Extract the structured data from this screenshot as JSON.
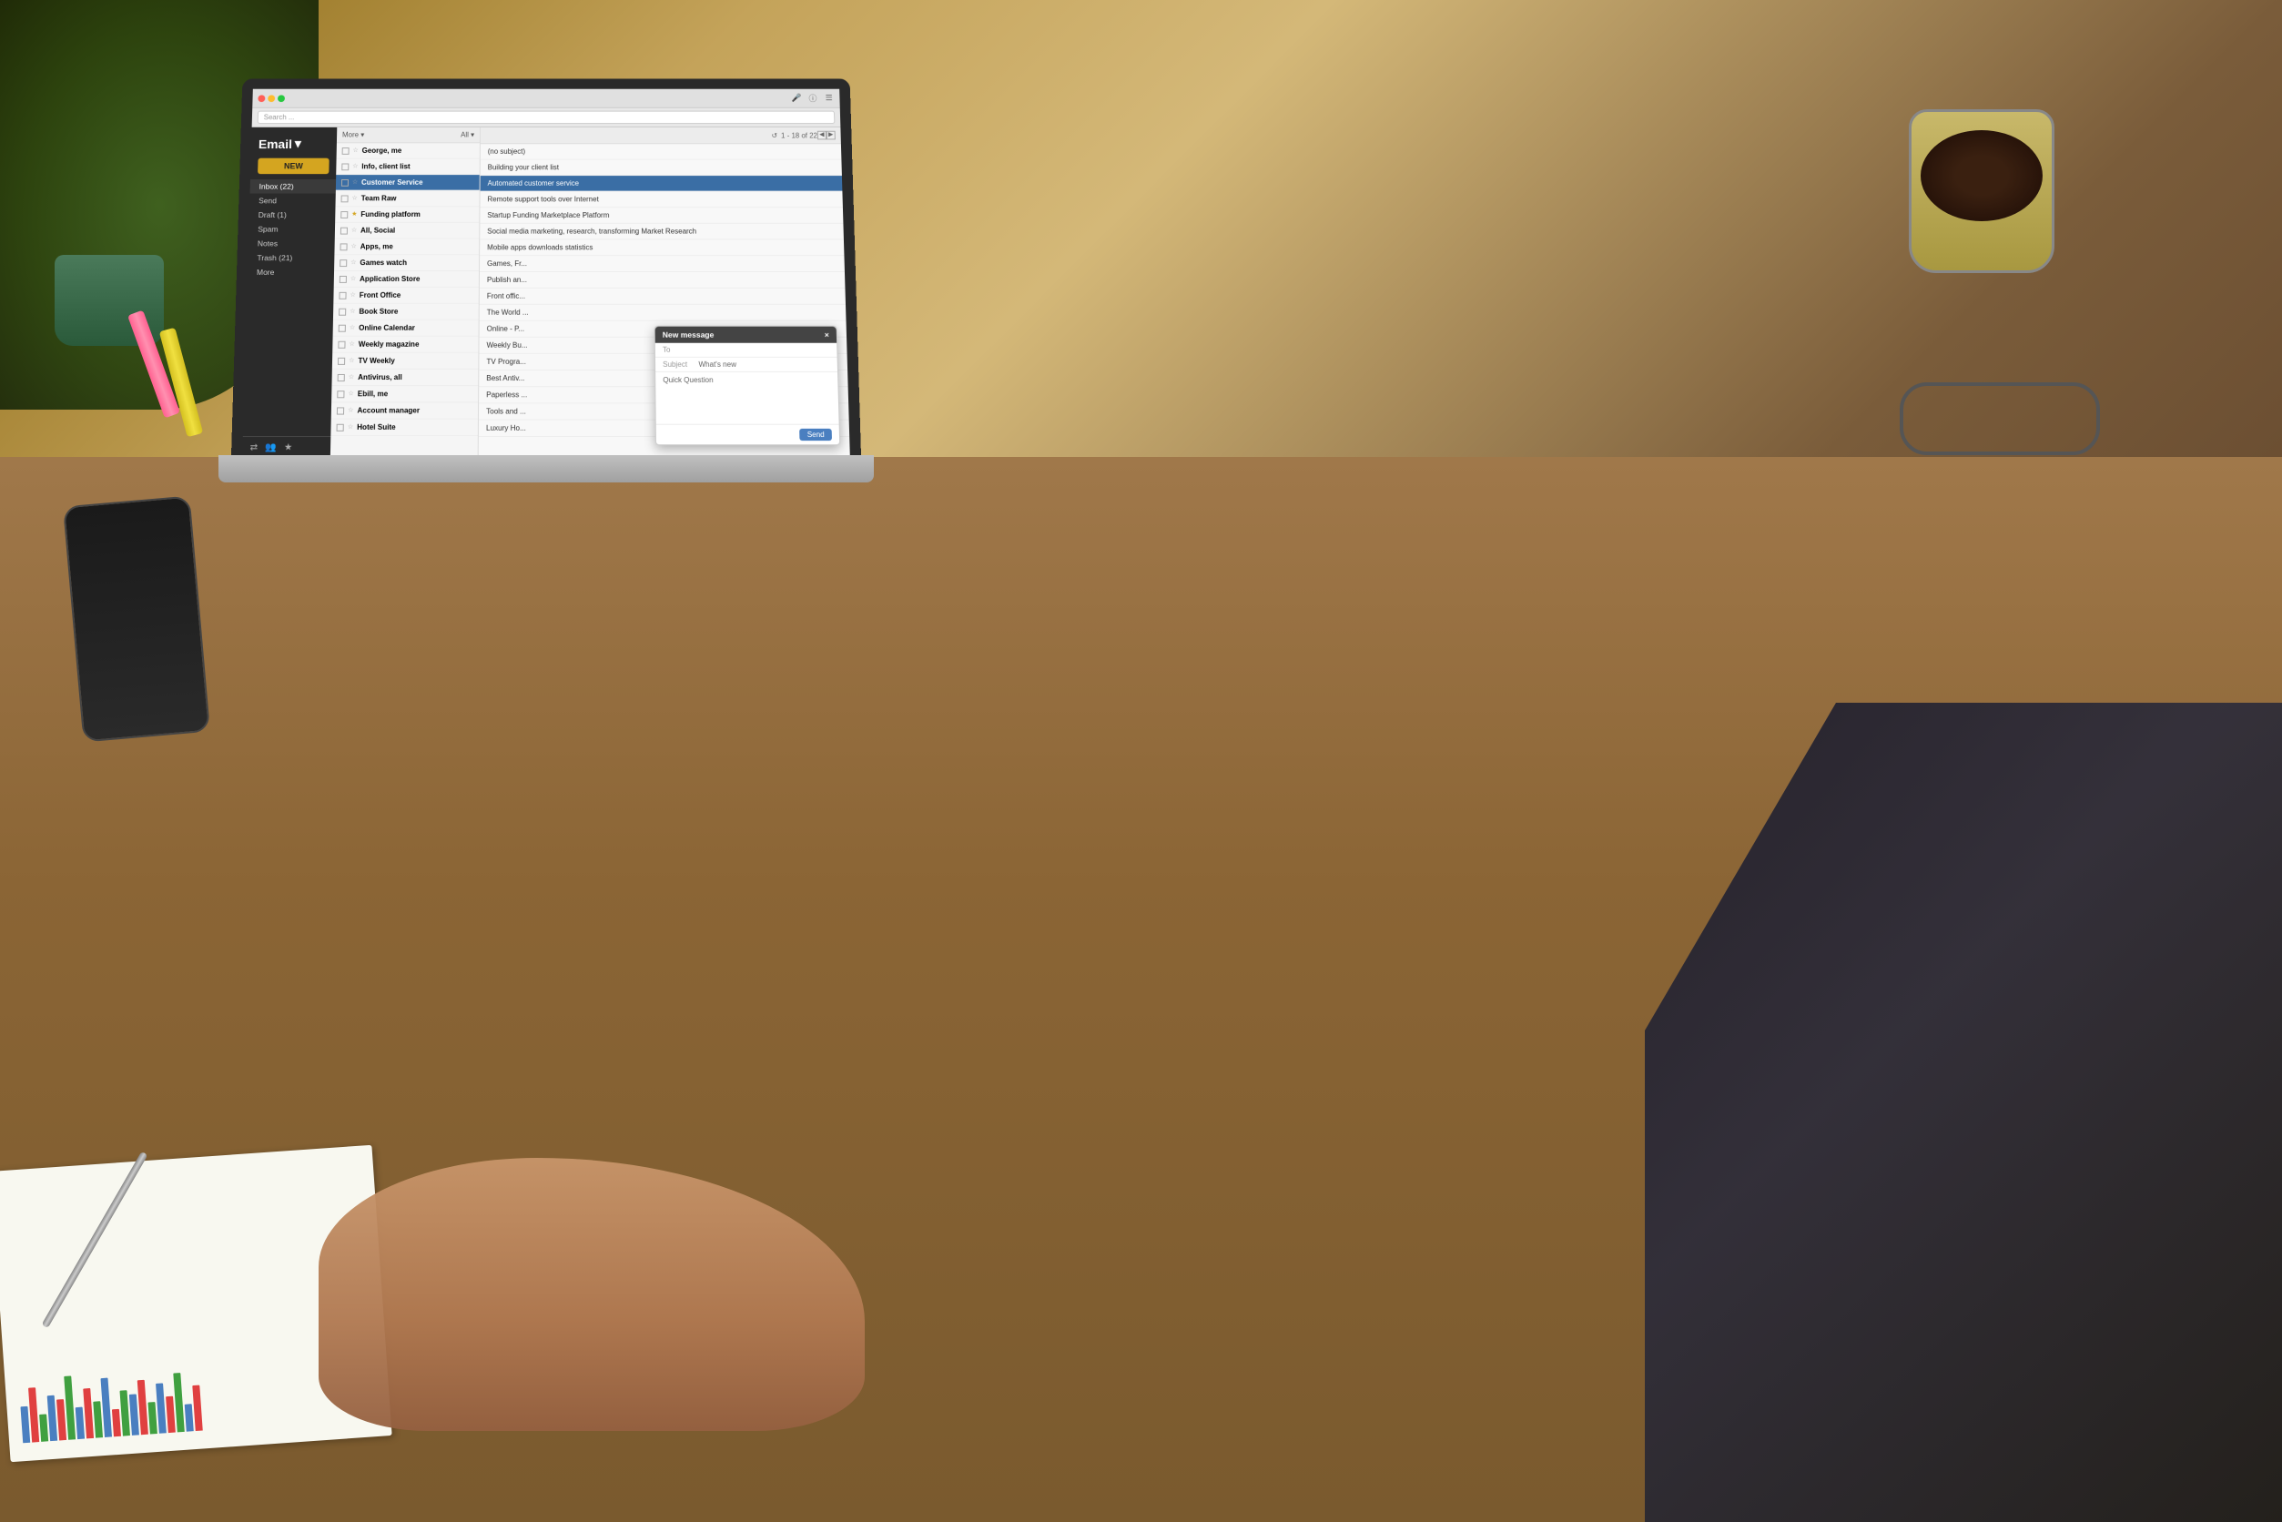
{
  "scene": {
    "bg_color": "#7a5c3a",
    "desk_color": "#9a7040"
  },
  "email_app": {
    "title": "Email",
    "title_arrow": "▾",
    "new_button": "NEW",
    "search_placeholder": "Search ...",
    "topbar": {
      "page_info": "1 - 18 of 22",
      "scroll_left": "◀",
      "scroll_right": "▶",
      "microphone_icon": "🎤",
      "hamburger_icon": "☰",
      "info_icon": "ⓘ"
    },
    "more_label": "More ▾",
    "all_label": "All ▾",
    "sidebar_items": [
      {
        "label": "Inbox (22)",
        "active": true
      },
      {
        "label": "Send",
        "active": false
      },
      {
        "label": "Draft (1)",
        "active": false
      },
      {
        "label": "Spam",
        "active": false
      },
      {
        "label": "Notes",
        "active": false
      },
      {
        "label": "Trash (21)",
        "active": false
      },
      {
        "label": "More",
        "active": false
      }
    ],
    "email_list": [
      {
        "sender": "George, me",
        "starred": false,
        "flag": false
      },
      {
        "sender": "Info, client list",
        "starred": false,
        "flag": false
      },
      {
        "sender": "Customer Service",
        "starred": false,
        "flag": false
      },
      {
        "sender": "Team Raw",
        "starred": false,
        "flag": false
      },
      {
        "sender": "Funding platform",
        "starred": false,
        "flag": true
      },
      {
        "sender": "All, Social",
        "starred": false,
        "flag": false
      },
      {
        "sender": "Apps, me",
        "starred": false,
        "flag": false
      },
      {
        "sender": "Games watch",
        "starred": false,
        "flag": false
      },
      {
        "sender": "Application Store",
        "starred": false,
        "flag": false
      },
      {
        "sender": "Front Office",
        "starred": false,
        "flag": false
      },
      {
        "sender": "Book Store",
        "starred": false,
        "flag": false
      },
      {
        "sender": "Online Calendar",
        "starred": false,
        "flag": false
      },
      {
        "sender": "Weekly magazine",
        "starred": false,
        "flag": false
      },
      {
        "sender": "TV Weekly",
        "starred": false,
        "flag": false
      },
      {
        "sender": "Antivirus, all",
        "starred": false,
        "flag": false
      },
      {
        "sender": "Ebill, me",
        "starred": false,
        "flag": false
      },
      {
        "sender": "Account manager",
        "starred": false,
        "flag": false
      },
      {
        "sender": "Hotel Suite",
        "starred": false,
        "flag": false
      }
    ],
    "subjects": [
      "(no subject)",
      "Building your client list",
      "Automated customer service",
      "Remote support tools over Internet",
      "Startup Funding Marketplace Platform",
      "Social media marketing, research, transforming Market Research",
      "Mobile apps downloads statistics",
      "Games, Fr...",
      "Publish an...",
      "Front offic...",
      "The World ...",
      "Online - P...",
      "Weekly Bu...",
      "TV Progra...",
      "Best Antiv...",
      "Paperless ...",
      "Tools and ...",
      "Luxury Ho..."
    ],
    "new_message": {
      "title": "New message",
      "to_label": "To",
      "subject_label": "Subject",
      "subject_value": "What's new",
      "body_label": "Quick Question",
      "send_button": "Send",
      "close_icon": "×"
    },
    "sidebar_footer_icons": [
      "⇄",
      "👥",
      "★"
    ]
  },
  "chart_data": {
    "bars": [
      {
        "color": "#4a7fc0",
        "height": 40
      },
      {
        "color": "#e04040",
        "height": 60
      },
      {
        "color": "#40a040",
        "height": 30
      },
      {
        "color": "#4a7fc0",
        "height": 50
      },
      {
        "color": "#e04040",
        "height": 45
      },
      {
        "color": "#40a040",
        "height": 70
      },
      {
        "color": "#4a7fc0",
        "height": 35
      },
      {
        "color": "#e04040",
        "height": 55
      },
      {
        "color": "#40a040",
        "height": 40
      },
      {
        "color": "#4a7fc0",
        "height": 65
      },
      {
        "color": "#e04040",
        "height": 30
      },
      {
        "color": "#40a040",
        "height": 50
      },
      {
        "color": "#4a7fc0",
        "height": 45
      },
      {
        "color": "#e04040",
        "height": 60
      },
      {
        "color": "#40a040",
        "height": 35
      },
      {
        "color": "#4a7fc0",
        "height": 55
      },
      {
        "color": "#e04040",
        "height": 40
      },
      {
        "color": "#40a040",
        "height": 65
      },
      {
        "color": "#4a7fc0",
        "height": 30
      },
      {
        "color": "#e04040",
        "height": 50
      }
    ]
  }
}
